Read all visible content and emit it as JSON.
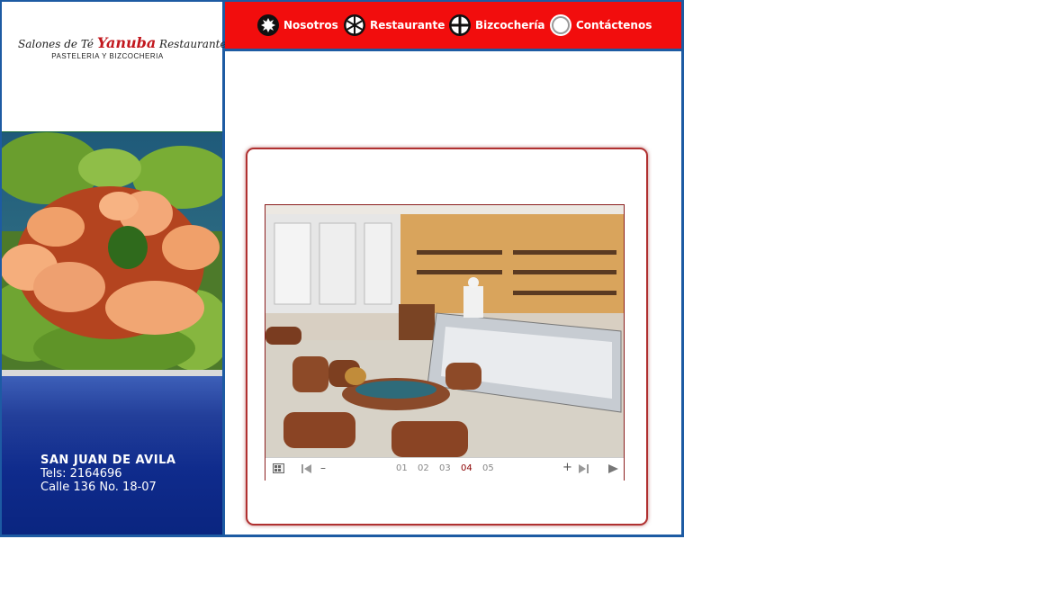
{
  "logo": {
    "line1_prefix": "Salones de Té",
    "brand": "Yanuba",
    "line1_suffix": "Restaurante",
    "tagline": "PASTELERIA Y BIZCOCHERIA"
  },
  "address": {
    "city": "SAN JUAN DE AVILA",
    "phone": "Tels:  2164696",
    "street": "Calle 136 No. 18-07"
  },
  "nav": {
    "items": [
      {
        "label": "Nosotros",
        "icon": "sun-icon"
      },
      {
        "label": "Restaurante",
        "icon": "wheel-icon"
      },
      {
        "label": "Bizcochería",
        "icon": "cross-icon"
      },
      {
        "label": "Contáctenos",
        "icon": "ring-icon"
      }
    ]
  },
  "slideshow": {
    "pages": [
      "01",
      "02",
      "03",
      "04",
      "05"
    ],
    "active_page": "04",
    "zoom_out": "–",
    "zoom_in": "+"
  },
  "colors": {
    "nav_bg": "#f20d0d",
    "frame_blue": "#1d5ba3",
    "panel_navy": "#0f2b8c",
    "active_page": "#8b0000"
  }
}
